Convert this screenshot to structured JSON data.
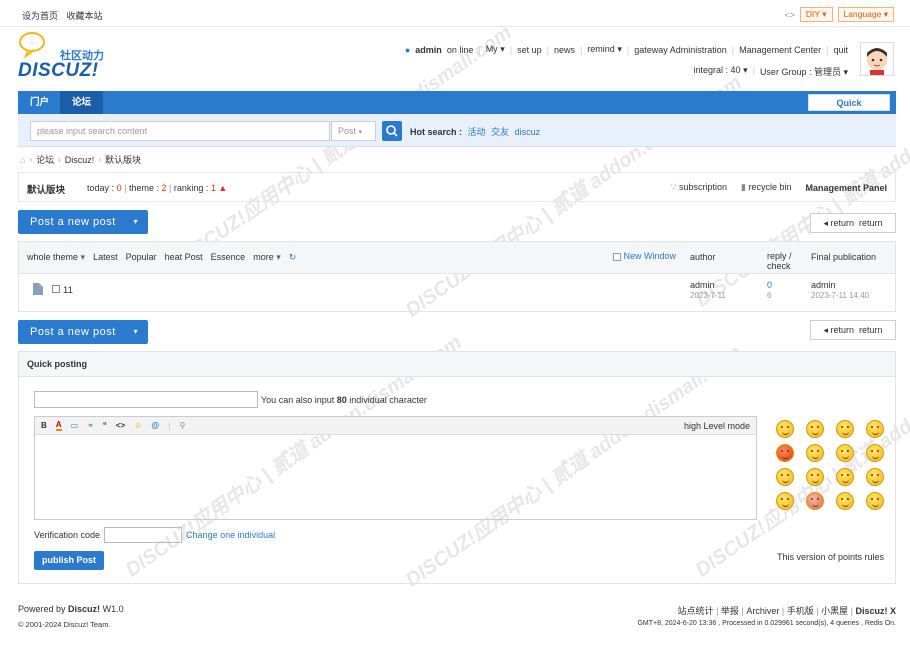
{
  "topbar": {
    "set_home": "设为首页",
    "bookmark": "收藏本站",
    "switch_icon": "<>",
    "diy": "DIY",
    "language": "Language"
  },
  "logo": {
    "cn": "社区动力",
    "en": "DISCUZ!"
  },
  "user": {
    "name": "admin",
    "status": "on line",
    "menu": [
      "My",
      "set up",
      "news",
      "remind",
      "gateway Administration",
      "Management Center",
      "quit"
    ],
    "integral_label": "integral : 40",
    "group_label": "User Group : 管理员"
  },
  "nav": {
    "tabs": [
      "门户",
      "论坛"
    ],
    "active": "论坛",
    "quick": "Quick"
  },
  "search": {
    "placeholder": "please input search content",
    "type": "Post",
    "hot_label": "Hot search :",
    "hot": [
      "活动",
      "交友",
      "discuz"
    ]
  },
  "breadcrumb": [
    "论坛",
    "Discuz!",
    "默认版块"
  ],
  "forum": {
    "name": "默认版块",
    "today_label": "today :",
    "today": "0",
    "theme_label": "theme :",
    "theme": "2",
    "ranking_label": "ranking :",
    "ranking": "1",
    "subscription": "subscription",
    "recycle": "recycle bin",
    "panel": "Management Panel"
  },
  "actions": {
    "new_post": "Post a new post",
    "return1": "return",
    "return2": "return"
  },
  "thread_header": {
    "filters": [
      "whole theme",
      "Latest",
      "Popular",
      "heat Post",
      "Essence",
      "more"
    ],
    "new_window": "New Window",
    "author": "author",
    "reply": "reply /",
    "check": "check",
    "final": "Final publication"
  },
  "threads": [
    {
      "title": "11",
      "author": "admin",
      "date": "2023-7-11",
      "replies": "0",
      "views": "6",
      "last_user": "admin",
      "last_time": "2023-7-11 14:40"
    }
  ],
  "quick_post": {
    "title": "Quick posting",
    "limit_prefix": "You can also input",
    "limit_num": "80",
    "limit_suffix": "individual character",
    "high_level": "high Level mode",
    "toolbar": [
      "B",
      "A",
      "▭",
      "⚭",
      "“",
      "<>",
      "☺",
      "@",
      "⚲"
    ],
    "verification_label": "Verification code",
    "change": "Change one individual",
    "publish": "publish Post",
    "points_rules": "This version of points rules"
  },
  "footer": {
    "powered_prefix": "Powered by",
    "powered_brand": "Discuz!",
    "version": "W1.0",
    "copyright": "© 2001-2024 Discuz! Team.",
    "links": [
      "站点统计",
      "举报",
      "Archiver",
      "手机版",
      "小黑屋",
      "Discuz! X"
    ],
    "stats": "GMT+8, 2024-6-20 13:36 , Processed in 0.029961 second(s), 4 queries , Redis On."
  },
  "colors": {
    "accent": "#2b7acd",
    "red": "#e0370f",
    "orange": "#e0600c"
  },
  "watermark": "DISCUZ!应用中心 | 贰道 addon.dismall.com"
}
